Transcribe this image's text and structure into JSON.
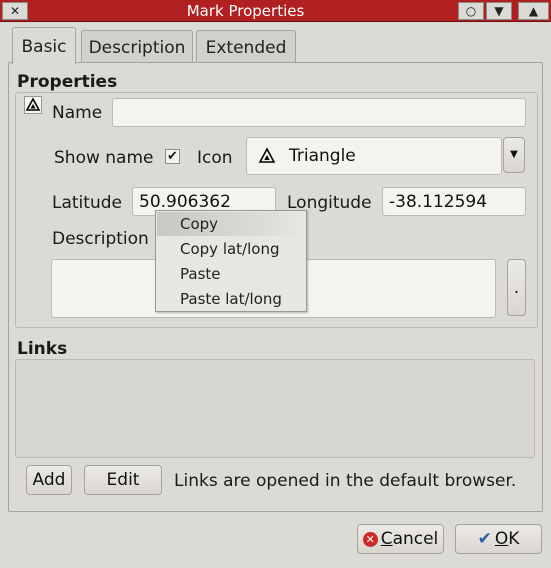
{
  "window": {
    "title": "Mark Properties",
    "close_icon": "close-icon",
    "circle_icon": "circle-icon",
    "minimize_icon": "triangle-down-icon",
    "maximize_icon": "triangle-up-icon"
  },
  "tabs": [
    {
      "label": "Basic",
      "active": true
    },
    {
      "label": "Description",
      "active": false
    },
    {
      "label": "Extended",
      "active": false
    }
  ],
  "properties": {
    "section_title": "Properties",
    "name_label": "Name",
    "name_value": "",
    "show_name_label": "Show name",
    "show_name_checked": true,
    "icon_label": "Icon",
    "icon_value": "Triangle",
    "latitude_label": "Latitude",
    "latitude_value": "50.906362",
    "longitude_label": "Longitude",
    "longitude_value": "-38.112594",
    "description_label": "Description",
    "description_button": "."
  },
  "context_menu": {
    "items": [
      "Copy",
      "Copy lat/long",
      "Paste",
      "Paste lat/long"
    ],
    "highlighted": "Copy"
  },
  "links": {
    "section_title": "Links",
    "add_label": "Add",
    "edit_label": "Edit",
    "note": "Links are opened in the default browser."
  },
  "footer": {
    "cancel_label": "Cancel",
    "ok_label": "OK",
    "cancel_color": "#cc2b2b",
    "ok_color": "#2d5fa8"
  }
}
